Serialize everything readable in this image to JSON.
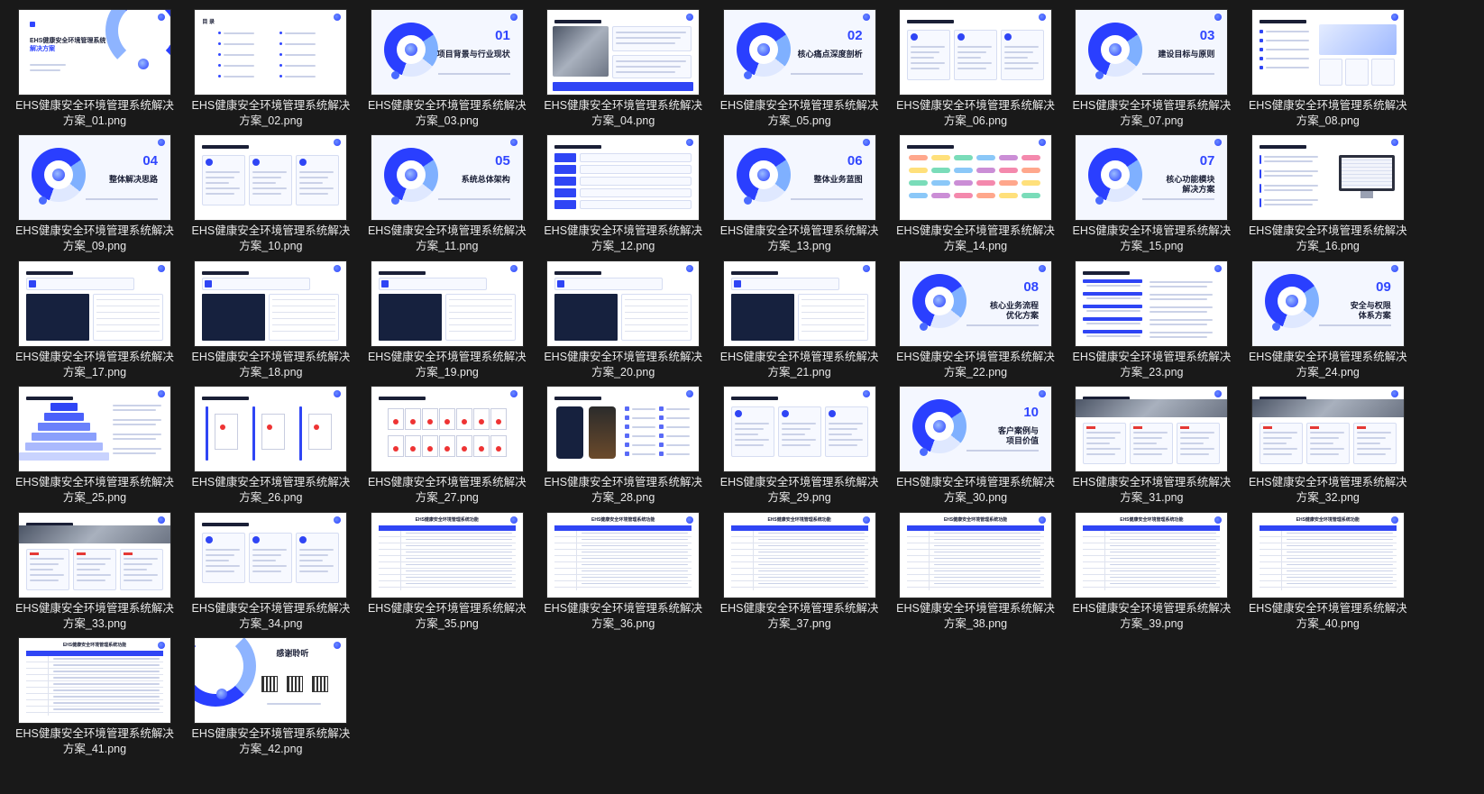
{
  "files": [
    {
      "name": "EHS健康安全环境管理系统解决方案_01.png",
      "kind": "cover",
      "heading": "EHS健康安全环境管理系统",
      "heading_accent": "解决方案"
    },
    {
      "name": "EHS健康安全环境管理系统解决方案_02.png",
      "kind": "toc",
      "heading": "目 录"
    },
    {
      "name": "EHS健康安全环境管理系统解决方案_03.png",
      "kind": "section",
      "num": "01",
      "heading": "项目背景与行业现状"
    },
    {
      "name": "EHS健康安全环境管理系统解决方案_04.png",
      "kind": "photo-text"
    },
    {
      "name": "EHS健康安全环境管理系统解决方案_05.png",
      "kind": "section",
      "num": "02",
      "heading": "核心痛点深度剖析"
    },
    {
      "name": "EHS健康安全环境管理系统解决方案_06.png",
      "kind": "cards"
    },
    {
      "name": "EHS健康安全环境管理系统解决方案_07.png",
      "kind": "section",
      "num": "03",
      "heading": "建设目标与原则"
    },
    {
      "name": "EHS健康安全环境管理系统解决方案_08.png",
      "kind": "list-image"
    },
    {
      "name": "EHS健康安全环境管理系统解决方案_09.png",
      "kind": "section",
      "num": "04",
      "heading": "整体解决思路"
    },
    {
      "name": "EHS健康安全环境管理系统解决方案_10.png",
      "kind": "cards"
    },
    {
      "name": "EHS健康安全环境管理系统解决方案_11.png",
      "kind": "section",
      "num": "05",
      "heading": "系统总体架构"
    },
    {
      "name": "EHS健康安全环境管理系统解决方案_12.png",
      "kind": "architecture"
    },
    {
      "name": "EHS健康安全环境管理系统解决方案_13.png",
      "kind": "section",
      "num": "06",
      "heading": "整体业务蓝图"
    },
    {
      "name": "EHS健康安全环境管理系统解决方案_14.png",
      "kind": "blueprint"
    },
    {
      "name": "EHS健康安全环境管理系统解决方案_15.png",
      "kind": "section",
      "num": "07",
      "heading": "核心功能模块\n解决方案"
    },
    {
      "name": "EHS健康安全环境管理系统解决方案_16.png",
      "kind": "monitor"
    },
    {
      "name": "EHS健康安全环境管理系统解决方案_17.png",
      "kind": "screenshot"
    },
    {
      "name": "EHS健康安全环境管理系统解决方案_18.png",
      "kind": "screenshot"
    },
    {
      "name": "EHS健康安全环境管理系统解决方案_19.png",
      "kind": "screenshot"
    },
    {
      "name": "EHS健康安全环境管理系统解决方案_20.png",
      "kind": "screenshot"
    },
    {
      "name": "EHS健康安全环境管理系统解决方案_21.png",
      "kind": "screenshot"
    },
    {
      "name": "EHS健康安全环境管理系统解决方案_22.png",
      "kind": "section",
      "num": "08",
      "heading": "核心业务流程\n优化方案"
    },
    {
      "name": "EHS健康安全环境管理系统解决方案_23.png",
      "kind": "flow"
    },
    {
      "name": "EHS健康安全环境管理系统解决方案_24.png",
      "kind": "section",
      "num": "09",
      "heading": "安全与权限\n体系方案"
    },
    {
      "name": "EHS健康安全环境管理系统解决方案_25.png",
      "kind": "pyramid"
    },
    {
      "name": "EHS健康安全环境管理系统解决方案_26.png",
      "kind": "certs"
    },
    {
      "name": "EHS健康安全环境管理系统解决方案_27.png",
      "kind": "certs-grid"
    },
    {
      "name": "EHS健康安全环境管理系统解决方案_28.png",
      "kind": "mobile"
    },
    {
      "name": "EHS健康安全环境管理系统解决方案_29.png",
      "kind": "cards"
    },
    {
      "name": "EHS健康安全环境管理系统解决方案_30.png",
      "kind": "section",
      "num": "10",
      "heading": "客户案例与\n项目价值"
    },
    {
      "name": "EHS健康安全环境管理系统解决方案_31.png",
      "kind": "case"
    },
    {
      "name": "EHS健康安全环境管理系统解决方案_32.png",
      "kind": "case"
    },
    {
      "name": "EHS健康安全环境管理系统解决方案_33.png",
      "kind": "case"
    },
    {
      "name": "EHS健康安全环境管理系统解决方案_34.png",
      "kind": "cards"
    },
    {
      "name": "EHS健康安全环境管理系统解决方案_35.png",
      "kind": "table",
      "heading": "EHS健康安全环境管理系统功能"
    },
    {
      "name": "EHS健康安全环境管理系统解决方案_36.png",
      "kind": "table",
      "heading": "EHS健康安全环境管理系统功能"
    },
    {
      "name": "EHS健康安全环境管理系统解决方案_37.png",
      "kind": "table",
      "heading": "EHS健康安全环境管理系统功能"
    },
    {
      "name": "EHS健康安全环境管理系统解决方案_38.png",
      "kind": "table",
      "heading": "EHS健康安全环境管理系统功能"
    },
    {
      "name": "EHS健康安全环境管理系统解决方案_39.png",
      "kind": "table",
      "heading": "EHS健康安全环境管理系统功能"
    },
    {
      "name": "EHS健康安全环境管理系统解决方案_40.png",
      "kind": "table",
      "heading": "EHS健康安全环境管理系统功能"
    },
    {
      "name": "EHS健康安全环境管理系统解决方案_41.png",
      "kind": "table",
      "heading": "EHS健康安全环境管理系统功能"
    },
    {
      "name": "EHS健康安全环境管理系统解决方案_42.png",
      "kind": "thanks",
      "heading": "感谢聆听"
    }
  ]
}
